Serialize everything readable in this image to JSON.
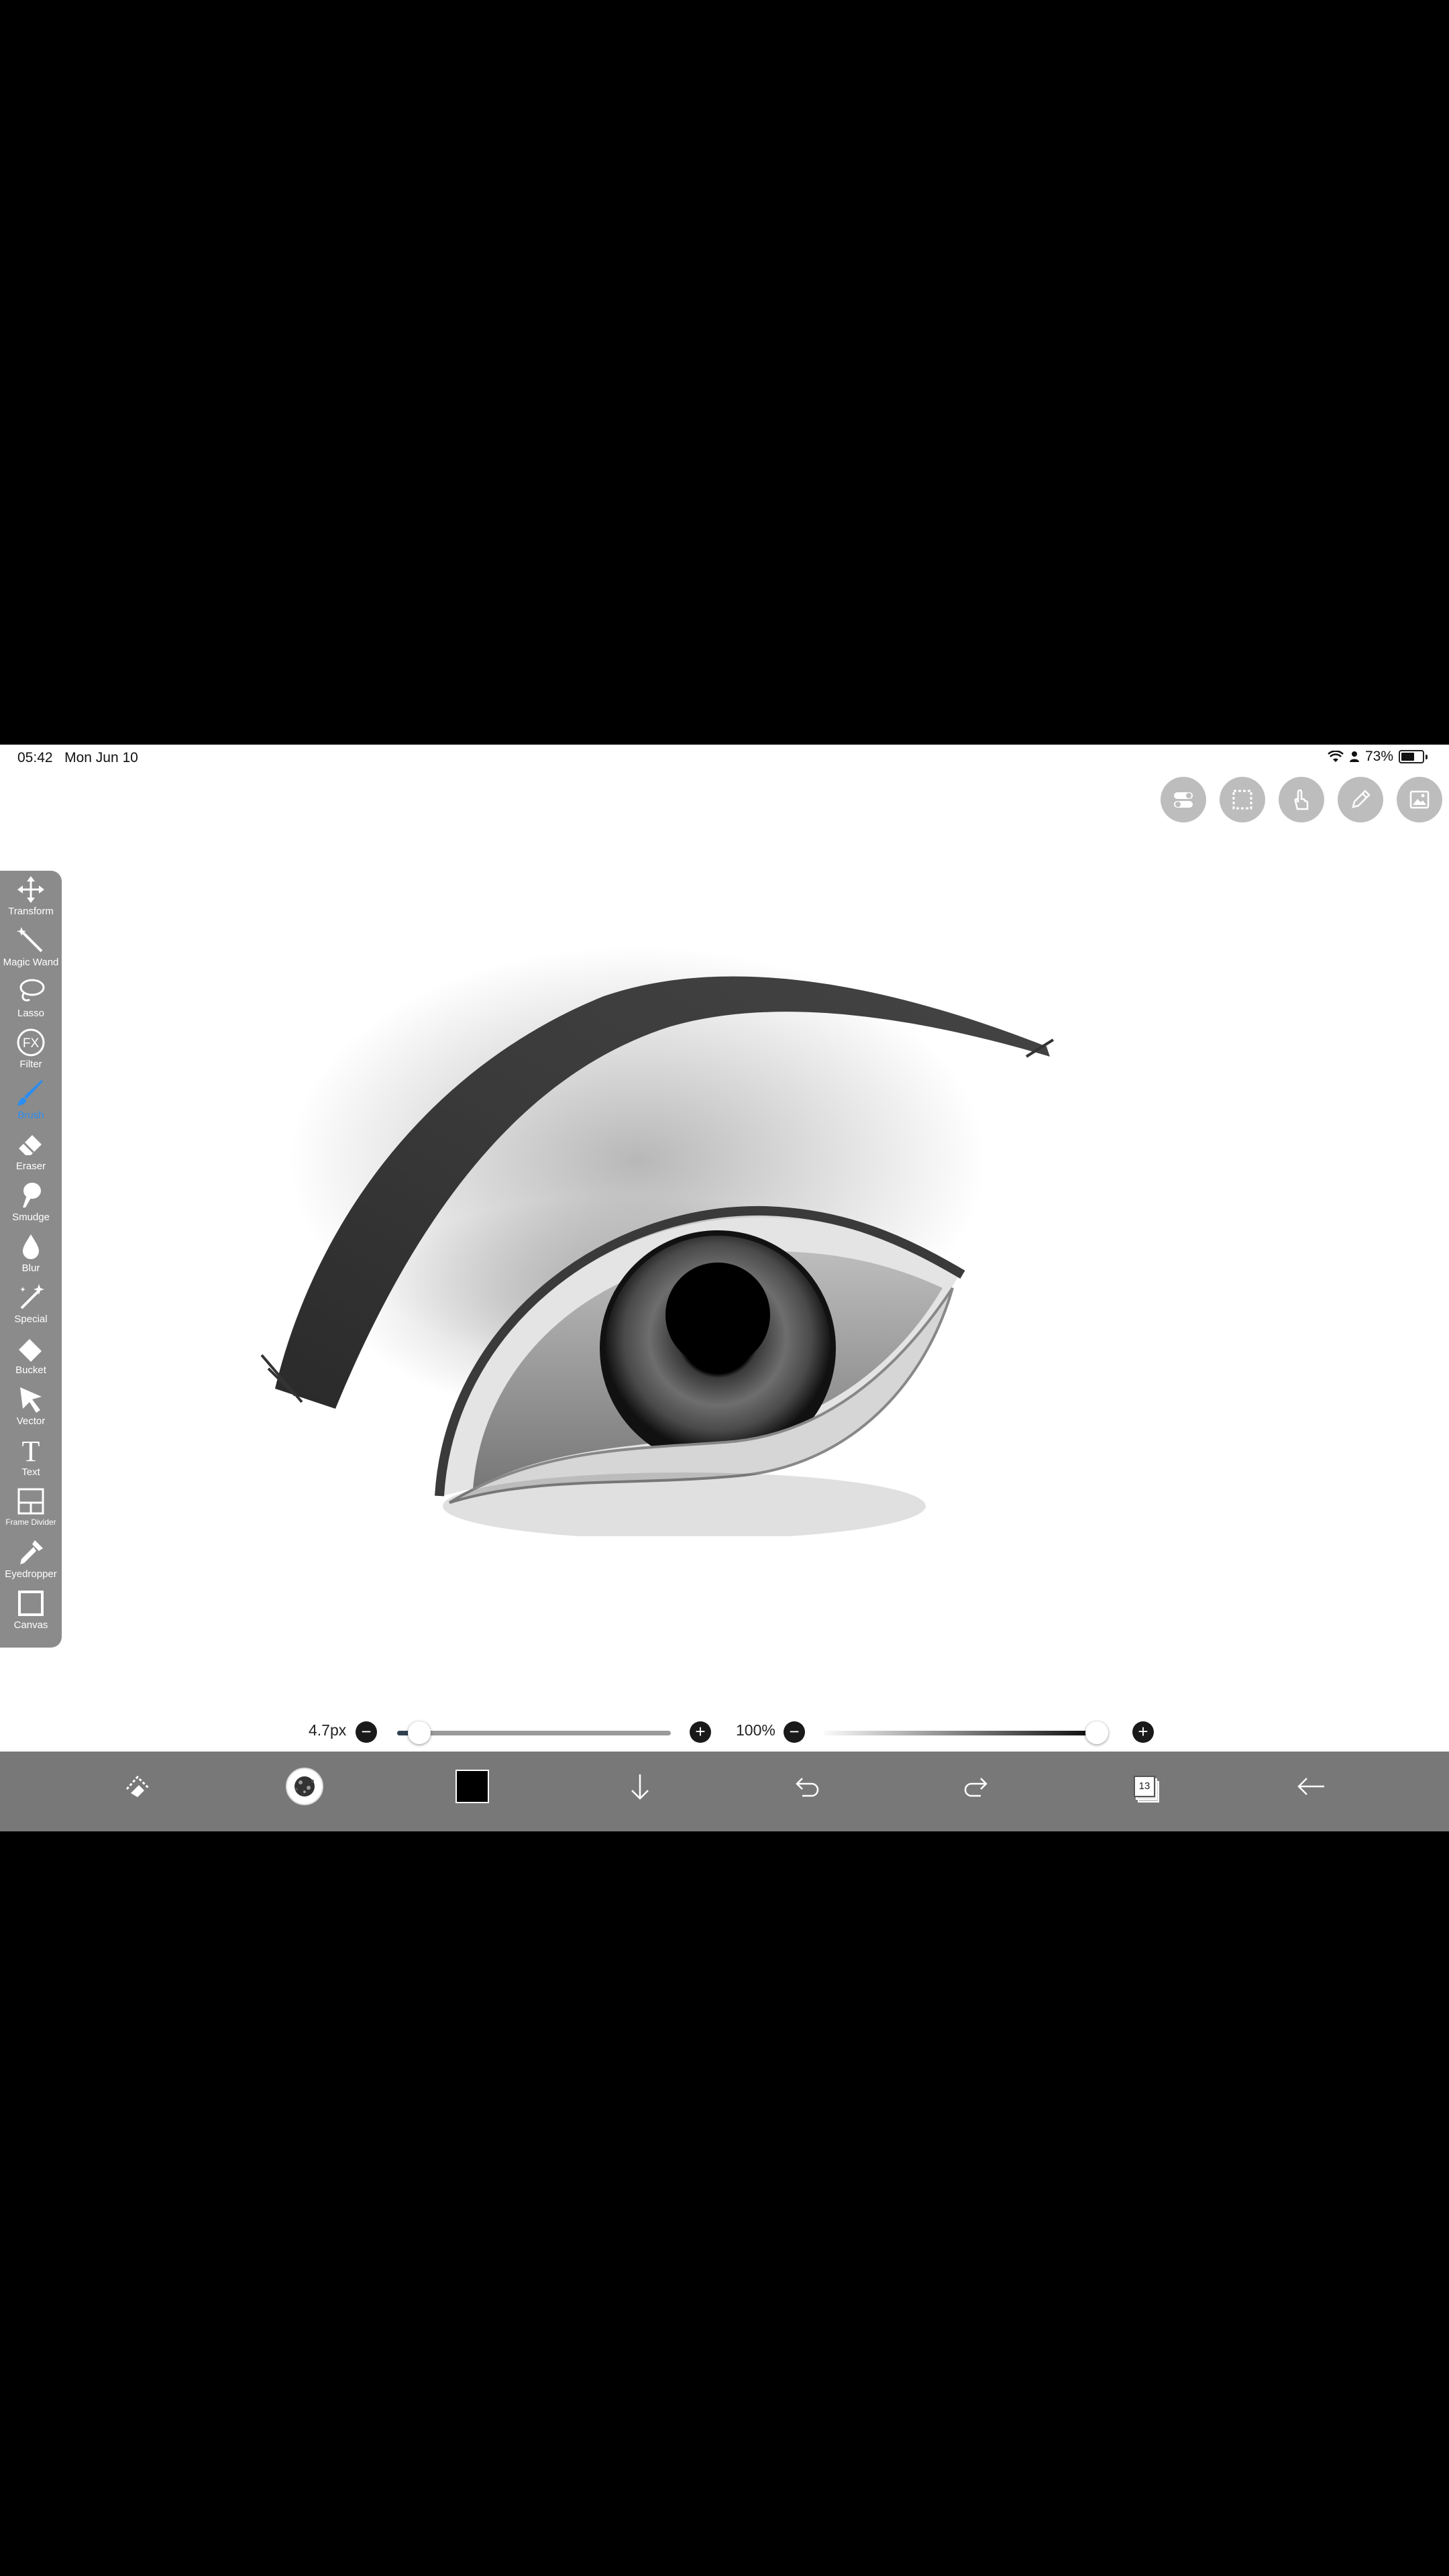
{
  "status_bar": {
    "time": "05:42",
    "date": "Mon Jun 10",
    "battery_percent": "73%",
    "battery_level": 0.73
  },
  "top_tools": [
    {
      "icon": "toggle-icon"
    },
    {
      "icon": "selection-icon"
    },
    {
      "icon": "hand-icon"
    },
    {
      "icon": "pencil-icon"
    },
    {
      "icon": "image-icon"
    }
  ],
  "toolbar": {
    "active_tool": "Brush",
    "tools": [
      {
        "label": "Transform",
        "icon": "move-arrows-icon"
      },
      {
        "label": "Magic Wand",
        "icon": "magic-wand-icon"
      },
      {
        "label": "Lasso",
        "icon": "lasso-icon"
      },
      {
        "label": "Filter",
        "icon": "fx-icon",
        "icon_text": "FX"
      },
      {
        "label": "Brush",
        "icon": "brush-icon"
      },
      {
        "label": "Eraser",
        "icon": "eraser-icon"
      },
      {
        "label": "Smudge",
        "icon": "smudge-icon"
      },
      {
        "label": "Blur",
        "icon": "drop-icon"
      },
      {
        "label": "Special",
        "icon": "special-brush-icon"
      },
      {
        "label": "Bucket",
        "icon": "bucket-icon"
      },
      {
        "label": "Vector",
        "icon": "arrow-cursor-icon"
      },
      {
        "label": "Text",
        "icon": "text-icon",
        "icon_text": "T"
      },
      {
        "label": "Frame Divider",
        "icon": "frame-divider-icon"
      },
      {
        "label": "Eyedropper",
        "icon": "eyedropper-icon"
      },
      {
        "label": "Canvas",
        "icon": "canvas-icon"
      }
    ]
  },
  "brush_controls": {
    "size_label": "4.7px",
    "size_level": 0.05,
    "opacity_label": "100%",
    "opacity_level": 1.0,
    "minus": "−",
    "plus": "+"
  },
  "bottom_bar": {
    "items": [
      "quick-access-icon",
      "brush-preview-icon",
      "color-swatch",
      "download-icon",
      "undo-icon",
      "redo-icon",
      "layers-icon",
      "back-icon"
    ],
    "color": "#000000",
    "layers_count": "13"
  },
  "colors": {
    "toolbar_bg": "#8b8b8b",
    "bottom_bar_bg": "#787878",
    "active_accent": "#2c8df0"
  }
}
